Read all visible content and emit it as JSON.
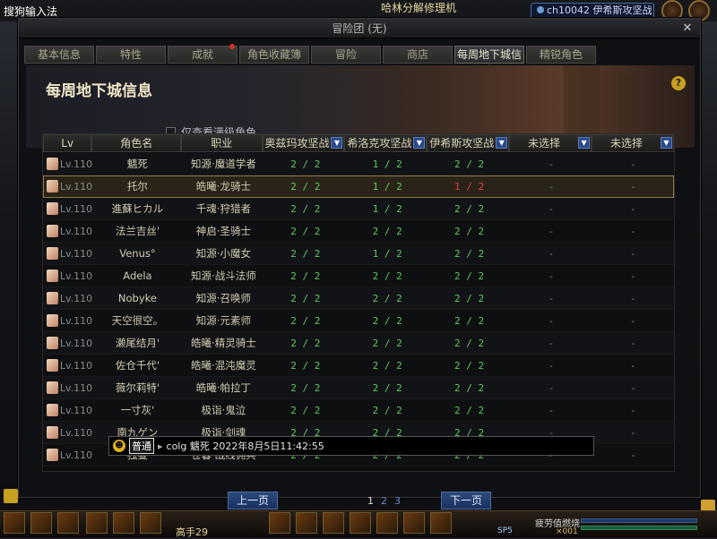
{
  "topbar": {
    "ime": "搜狗输入法",
    "center": "哈林分解修理机",
    "channel": "ch10042 伊希斯攻坚战"
  },
  "window": {
    "title": "冒险团 (无)",
    "close": "✕"
  },
  "tabs": [
    {
      "label": "基本信息"
    },
    {
      "label": "特性"
    },
    {
      "label": "成就",
      "alert": true
    },
    {
      "label": "角色收藏簿"
    },
    {
      "label": "冒险"
    },
    {
      "label": "商店"
    },
    {
      "label": "每周地下城信息",
      "active": true
    },
    {
      "label": "精锐角色"
    }
  ],
  "page": {
    "title": "每周地下城信息",
    "help": "?",
    "filter_label": "仅查看满级角色"
  },
  "table": {
    "headers": {
      "lv": "Lv",
      "name": "角色名",
      "job": "职业",
      "d1": "奥兹玛攻坚战",
      "d2": "希洛克攻坚战",
      "d3": "伊希斯攻坚战",
      "d4": "未选择",
      "d5": "未选择"
    },
    "rows": [
      {
        "lv": "Lv.110",
        "name": "魑死",
        "job": "知源·魔道学者",
        "d1": "2 / 2",
        "d2": "1 / 2",
        "d3": "2 / 2",
        "d4": "-",
        "d5": "-"
      },
      {
        "lv": "Lv.110",
        "name": "托尔",
        "job": "皓曦·龙骑士",
        "d1": "2 / 2",
        "d2": "1 / 2",
        "d3": "1 / 2",
        "d3red": true,
        "d4": "-",
        "d5": "-",
        "selected": true
      },
      {
        "lv": "Lv.110",
        "name": "進蘇ヒカル",
        "job": "千魂·狩猎者",
        "d1": "2 / 2",
        "d2": "1 / 2",
        "d3": "2 / 2",
        "d4": "-",
        "d5": "-"
      },
      {
        "lv": "Lv.110",
        "name": "法兰吉丝'",
        "job": "神启·圣骑士",
        "d1": "2 / 2",
        "d2": "2 / 2",
        "d3": "2 / 2",
        "d4": "-",
        "d5": "-"
      },
      {
        "lv": "Lv.110",
        "name": "Venus°",
        "job": "知源·小魔女",
        "d1": "2 / 2",
        "d2": "1 / 2",
        "d3": "2 / 2",
        "d4": "-",
        "d5": "-"
      },
      {
        "lv": "Lv.110",
        "name": "Adela",
        "job": "知源·战斗法师",
        "d1": "2 / 2",
        "d2": "2 / 2",
        "d3": "2 / 2",
        "d4": "-",
        "d5": "-"
      },
      {
        "lv": "Lv.110",
        "name": "Nobyke",
        "job": "知源·召唤师",
        "d1": "2 / 2",
        "d2": "2 / 2",
        "d3": "2 / 2",
        "d4": "-",
        "d5": "-"
      },
      {
        "lv": "Lv.110",
        "name": "天空很空。",
        "job": "知源·元素师",
        "d1": "2 / 2",
        "d2": "2 / 2",
        "d3": "2 / 2",
        "d4": "-",
        "d5": "-"
      },
      {
        "lv": "Lv.110",
        "name": "濑尾结月'",
        "job": "皓曦·精灵骑士",
        "d1": "2 / 2",
        "d2": "2 / 2",
        "d3": "2 / 2",
        "d4": "-",
        "d5": "-"
      },
      {
        "lv": "Lv.110",
        "name": "佐仓千代'",
        "job": "皓曦·混沌魔灵",
        "d1": "2 / 2",
        "d2": "2 / 2",
        "d3": "2 / 2",
        "d4": "-",
        "d5": "-"
      },
      {
        "lv": "Lv.110",
        "name": "薇尔莉特'",
        "job": "皓曦·帕拉丁",
        "d1": "2 / 2",
        "d2": "2 / 2",
        "d3": "2 / 2",
        "d4": "-",
        "d5": "-"
      },
      {
        "lv": "Lv.110",
        "name": "一寸灰'",
        "job": "极诣·鬼泣",
        "d1": "2 / 2",
        "d2": "2 / 2",
        "d3": "2 / 2",
        "d4": "-",
        "d5": "-"
      },
      {
        "lv": "Lv.110",
        "name": "南九ゲン",
        "job": "极诣·剑魂",
        "d1": "2 / 2",
        "d2": "2 / 2",
        "d3": "2 / 2",
        "d4": "-",
        "d5": "-"
      },
      {
        "lv": "Lv.110",
        "name": "独曼",
        "job": "苍暮·战线佣兵",
        "d1": "2 / 2",
        "d2": "2 / 2",
        "d3": "2 / 2",
        "d4": "-",
        "d5": "-"
      }
    ]
  },
  "tooltip": {
    "badge": "普通",
    "text": "colg 魑死 2022年8月5日11:42:55"
  },
  "pager": {
    "prev": "上一页",
    "next": "下一页",
    "pages": [
      "1",
      "2",
      "3"
    ]
  },
  "bottom": {
    "level": "高手29",
    "fatigue": "疲劳值燃烧",
    "sp": "SP5",
    "gold": "×001"
  },
  "colors": {
    "green": "#5ec85e",
    "red": "#e04040",
    "accent": "#2a4a8a"
  }
}
